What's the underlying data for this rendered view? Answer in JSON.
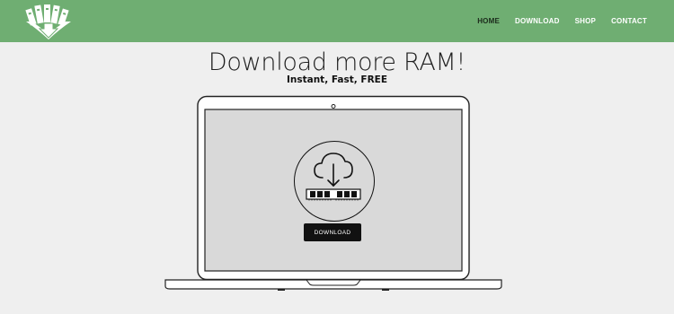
{
  "brand": {
    "logo_icon": "download-ram-logo-icon",
    "accent": "#6fae72"
  },
  "nav": {
    "items": [
      {
        "label": "HOME",
        "active": true
      },
      {
        "label": "DOWNLOAD",
        "active": false
      },
      {
        "label": "SHOP",
        "active": false
      },
      {
        "label": "CONTACT",
        "active": false
      }
    ]
  },
  "hero": {
    "title": "Download more RAM!",
    "subtitle": "Instant, Fast, FREE"
  },
  "screen": {
    "icons": [
      "laptop-icon",
      "cloud-download-icon",
      "ram-stick-icon"
    ],
    "button_label": "DOWNLOAD"
  }
}
